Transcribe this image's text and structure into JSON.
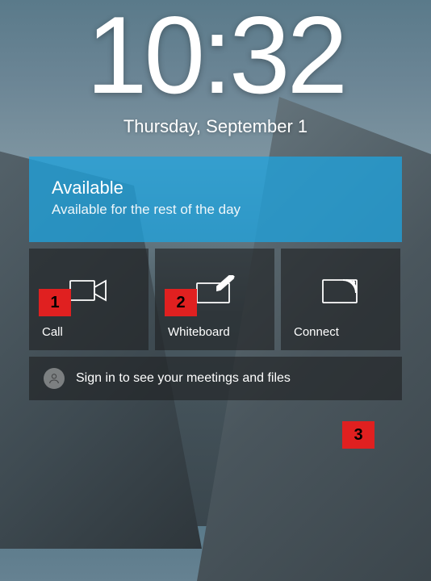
{
  "time": "10:32",
  "date": "Thursday, September 1",
  "status": {
    "title": "Available",
    "subtitle": "Available for the rest of the day"
  },
  "actions": {
    "call": {
      "label": "Call",
      "icon": "video-camera-icon"
    },
    "whiteboard": {
      "label": "Whiteboard",
      "icon": "whiteboard-icon"
    },
    "connect": {
      "label": "Connect",
      "icon": "cast-icon"
    }
  },
  "signin": {
    "text": "Sign in to see your meetings and files"
  },
  "annotations": {
    "a1": "1",
    "a2": "2",
    "a3": "3"
  },
  "colors": {
    "status_tile": "#20a2db",
    "dark_tile": "rgba(30,32,34,0.62)",
    "annotation_red": "#e02020"
  }
}
